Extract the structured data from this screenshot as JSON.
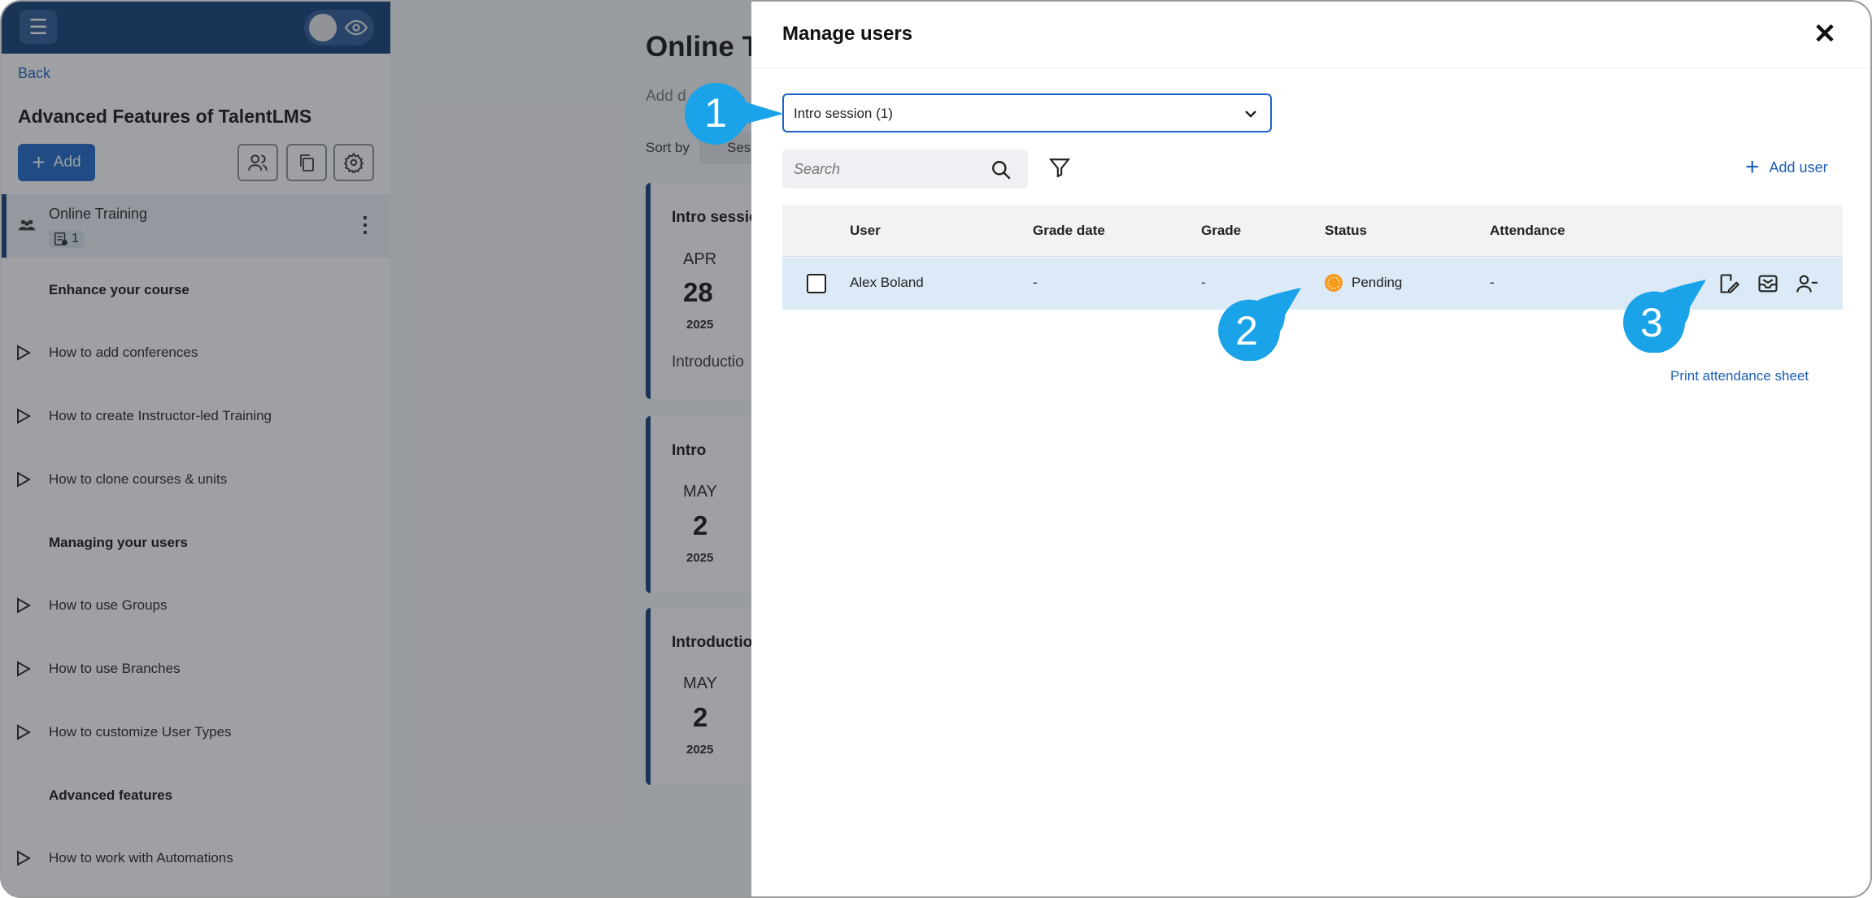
{
  "sidebar": {
    "back": "Back",
    "course_title": "Advanced Features of TalentLMS",
    "add_label": "Add",
    "active_unit": {
      "label": "Online Training",
      "badge_count": "1"
    },
    "sections": [
      {
        "heading": "Enhance your course"
      },
      {
        "heading": "Managing your users"
      },
      {
        "heading": "Advanced features"
      }
    ],
    "items": [
      "How to add conferences",
      "How to create Instructor-led Training",
      "How to clone courses & units",
      "How to use Groups",
      "How to use Branches",
      "How to customize User Types",
      "How to work with Automations"
    ]
  },
  "content": {
    "title": "Online T",
    "description": "Add d",
    "sort_label": "Sort by",
    "sort_value": "Ses",
    "cards": [
      {
        "title": "Intro sessio",
        "month": "APR",
        "day": "28",
        "year": "2025",
        "desc": "Introductio"
      },
      {
        "title": "Intro",
        "month": "MAY",
        "day": "2",
        "year": "2025",
        "desc": ""
      },
      {
        "title": "Introductio",
        "month": "MAY",
        "day": "2",
        "year": "2025",
        "desc": ""
      }
    ]
  },
  "modal": {
    "title": "Manage users",
    "session_value": "Intro session (1)",
    "search_placeholder": "Search",
    "add_user": "Add user",
    "columns": [
      "User",
      "Grade date",
      "Grade",
      "Status",
      "Attendance"
    ],
    "rows": [
      {
        "user": "Alex Boland",
        "grade_date": "-",
        "grade": "-",
        "status": "Pending",
        "attendance": "-"
      }
    ],
    "print_link": "Print attendance sheet"
  },
  "callouts": [
    "1",
    "2",
    "3"
  ],
  "colors": {
    "brand_dark": "#0d3b75",
    "primary": "#1a64c8",
    "link": "#1d5fb5",
    "callout": "#1aa3e8",
    "pending": "#f39c1f",
    "row_highlight": "#dce9f7"
  }
}
